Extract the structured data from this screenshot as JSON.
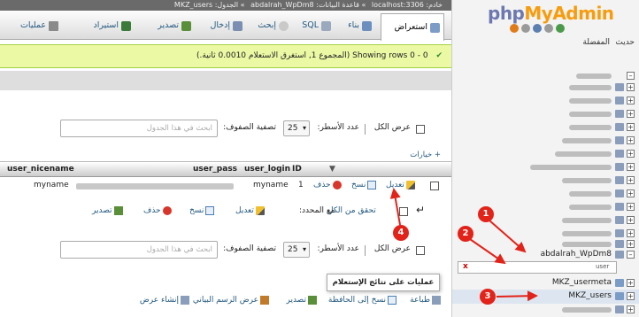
{
  "breadcrumb": {
    "server": "خادم: localhost:3306",
    "database": "قاعدة البيانات: abdalrah_WpDm8",
    "table": "الجدول: MKZ_users"
  },
  "tabs": [
    {
      "label": "استعراض",
      "active": true
    },
    {
      "label": "بناء"
    },
    {
      "label": "SQL"
    },
    {
      "label": "إبحث"
    },
    {
      "label": "إدخال"
    },
    {
      "label": "تصدير"
    },
    {
      "label": "استيراد"
    },
    {
      "label": "عمليات"
    }
  ],
  "success_message": "Showing rows 0 - 0 (المجموع 1, استغرق الاستعلام 0.0010 ثانية.)",
  "nav_top": {
    "show_all": "عرض الكل",
    "rows_label": "عدد الأسطر:",
    "rows_value": "25",
    "filter_label": "تصفية الصفوف:",
    "filter_placeholder": "ابحث في هذا الجدول"
  },
  "options_link": "+ خيارات",
  "columns": [
    "ID",
    "user_login",
    "user_pass",
    "user_nicename"
  ],
  "row": {
    "id": "1",
    "user_login": "myname",
    "user_nicename": "myname"
  },
  "row_actions": {
    "edit": "تعديل",
    "copy": "نسخ",
    "delete": "حذف"
  },
  "bulk": {
    "check_all": "تحقق من الكل",
    "with_selected": "مع المحدد:",
    "edit": "تعديل",
    "copy": "نسخ",
    "delete": "حذف",
    "export": "تصدير"
  },
  "nav_bottom": {
    "show_all": "عرض الكل",
    "rows_label": "عدد الأسطر:",
    "rows_value": "25",
    "filter_label": "تصفية الصفوف:",
    "filter_placeholder": "ابحث في هذا الجدول"
  },
  "ops_tooltip": "عمليات على نتائج الإستعلام",
  "ops": [
    "طباعة",
    "نسخ إلى الحافظة",
    "تصدير",
    "عرض الرسم البياني",
    "إنشاء عرض"
  ],
  "sidebar": {
    "logo_php": "php",
    "logo_my": "MyAdmin",
    "tab_recent": "حديث",
    "tab_favorites": "المفضلة",
    "database": "abdalrah_WpDm8",
    "filter_value": "user",
    "tables": [
      "MKZ_usermeta",
      "MKZ_users"
    ]
  },
  "badges": [
    "1",
    "2",
    "3",
    "4"
  ],
  "colors": {
    "accent": "#235a81",
    "success_bg": "#ebf8a4",
    "badge": "#e2231a"
  }
}
